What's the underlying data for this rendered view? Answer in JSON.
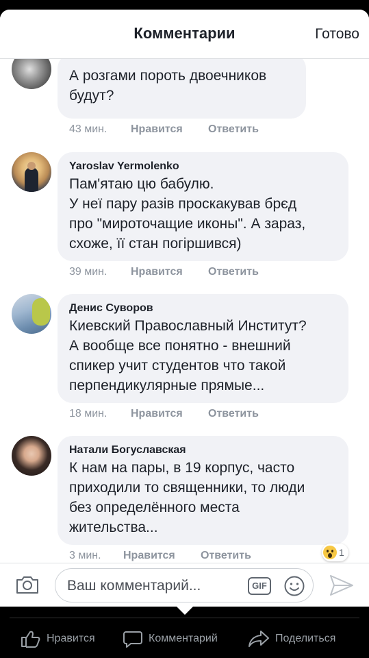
{
  "header": {
    "title": "Комментарии",
    "done_label": "Готово"
  },
  "comments": [
    {
      "author": "",
      "text_lines": [
        "А розгами пороть двоечников",
        "будут?"
      ],
      "time": "43 мин.",
      "like_label": "Нравится",
      "reply_label": "Ответить"
    },
    {
      "author": "Yaroslav Yermolenko",
      "text_lines": [
        "Пам'ятаю цю бабулю.",
        "У неї пару разів проскакував брєд",
        "про \"мироточащие иконы\". А зараз,",
        "схоже, її стан погіршився)"
      ],
      "time": "39 мин.",
      "like_label": "Нравится",
      "reply_label": "Ответить"
    },
    {
      "author": "Денис Суворов",
      "text_lines": [
        "Киевский Православный Институт?",
        "А вообще все понятно - внешний",
        "спикер учит студентов что такой",
        "перпендикулярные прямые..."
      ],
      "time": "18 мин.",
      "like_label": "Нравится",
      "reply_label": "Ответить"
    },
    {
      "author": "Натали Богуславская",
      "text_lines": [
        "К нам на пары, в 19 корпус, часто",
        "приходили то священники, то люди",
        "без определённого места",
        "жительства..."
      ],
      "time": "3 мин.",
      "like_label": "Нравится",
      "reply_label": "Ответить",
      "reaction_icon": "wow-emoji-icon",
      "reaction_count": "1"
    }
  ],
  "composer": {
    "placeholder": "Ваш комментарий...",
    "gif_label": "GIF",
    "camera_icon": "camera-icon",
    "emoji_icon": "emoji-icon",
    "send_icon": "send-icon"
  },
  "bottom_bar": {
    "like_label": "Нравится",
    "comment_label": "Комментарий",
    "share_label": "Поделиться"
  },
  "colors": {
    "bubble": "#f1f2f6",
    "meta_text": "#8d949e",
    "text": "#1d2129"
  }
}
